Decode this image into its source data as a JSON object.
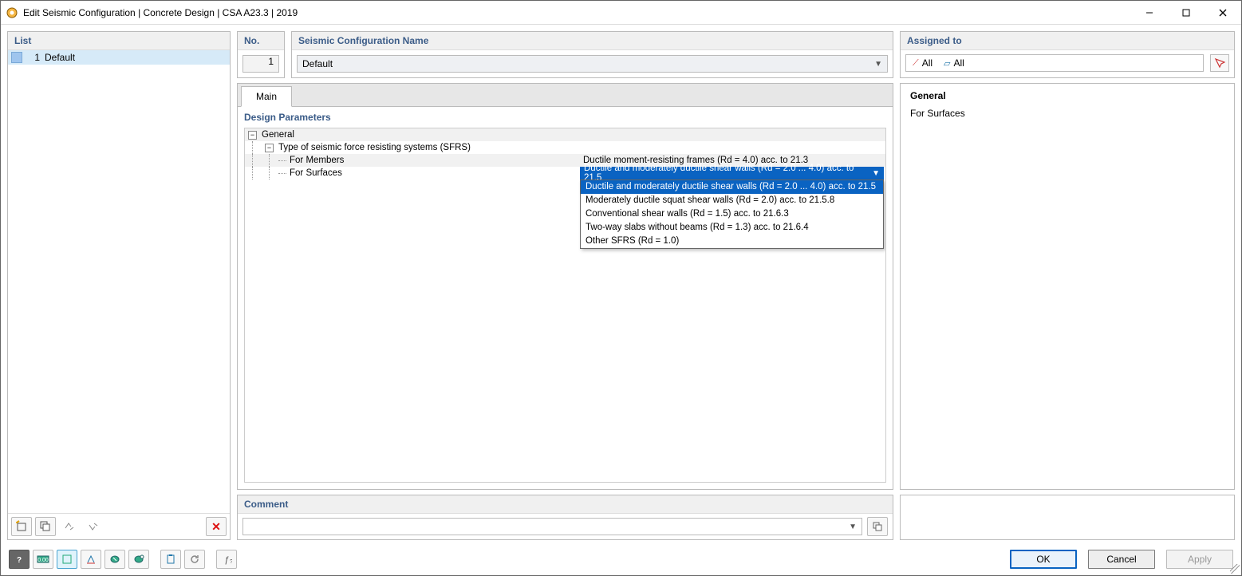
{
  "window": {
    "title": "Edit Seismic Configuration | Concrete Design | CSA A23.3 | 2019"
  },
  "left": {
    "header": "List",
    "items": [
      {
        "index": "1",
        "name": "Default"
      }
    ]
  },
  "top": {
    "no_header": "No.",
    "no_value": "1",
    "name_header": "Seismic Configuration Name",
    "name_value": "Default",
    "assigned_header": "Assigned to",
    "assigned_all1": "All",
    "assigned_all2": "All"
  },
  "tabs": {
    "main": "Main"
  },
  "params": {
    "header": "Design Parameters",
    "general": "General",
    "sfrs": "Type of seismic force resisting systems (SFRS)",
    "for_members": "For Members",
    "for_members_value": "Ductile moment-resisting frames (Rd = 4.0) acc. to 21.3",
    "for_surfaces": "For Surfaces",
    "for_surfaces_value": "Ductile and moderately ductile shear walls (Rd = 2.0 ... 4.0) acc. to 21.5",
    "dropdown": [
      "Ductile and moderately ductile shear walls (Rd = 2.0 ... 4.0) acc. to 21.5",
      "Moderately ductile squat shear walls (Rd = 2.0) acc. to 21.5.8",
      "Conventional shear walls (Rd = 1.5) acc. to 21.6.3",
      "Two-way slabs without beams (Rd = 1.3) acc. to 21.6.4",
      "Other SFRS (Rd = 1.0)"
    ]
  },
  "info": {
    "title": "General",
    "line1": "For Surfaces"
  },
  "comment": {
    "header": "Comment"
  },
  "buttons": {
    "ok": "OK",
    "cancel": "Cancel",
    "apply": "Apply"
  }
}
